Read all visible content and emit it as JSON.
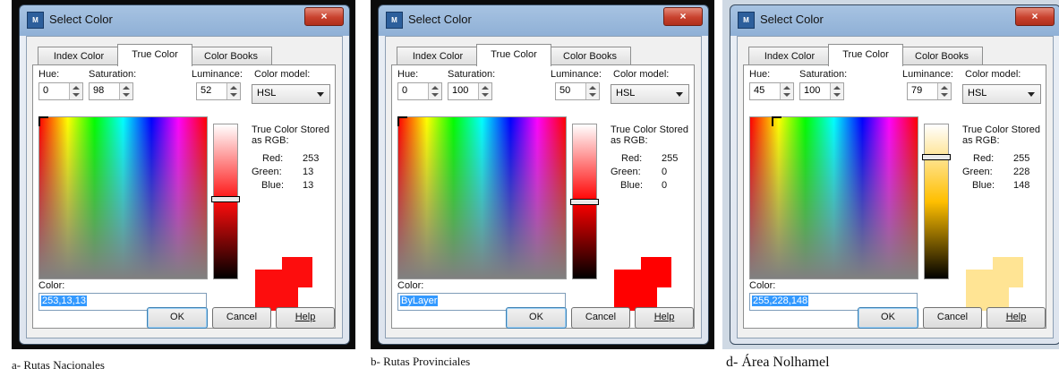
{
  "dialog_common": {
    "title": "Select Color",
    "close": "×",
    "app_icon": "M",
    "tabs": [
      "Index Color",
      "True Color",
      "Color Books"
    ],
    "labels": {
      "hue": "Hue:",
      "saturation": "Saturation:",
      "luminance": "Luminance:",
      "color_model": "Color model:",
      "stored": "True Color Stored as RGB:",
      "red": "Red:",
      "green": "Green:",
      "blue": "Blue:",
      "color": "Color:"
    },
    "buttons": {
      "ok": "OK",
      "cancel": "Cancel",
      "help": "Help"
    }
  },
  "panels": [
    {
      "hue": "0",
      "saturation": "98",
      "luminance": "52",
      "color_model": "HSL",
      "red": "253",
      "green": "13",
      "blue": "13",
      "color_value": "253,13,13",
      "luminance_level": 0.52,
      "swatch_color": "#fd0d0d",
      "bar_color": "#fd0d0d",
      "caption": "a- Rutas Nacionales"
    },
    {
      "hue": "0",
      "saturation": "100",
      "luminance": "50",
      "color_model": "HSL",
      "red": "255",
      "green": "0",
      "blue": "0",
      "color_value": "ByLayer",
      "luminance_level": 0.5,
      "swatch_color": "#ff0000",
      "bar_color": "#ff0000",
      "caption": "b- Rutas Provinciales"
    },
    {
      "hue": "45",
      "saturation": "100",
      "luminance": "79",
      "color_model": "HSL",
      "red": "255",
      "green": "228",
      "blue": "148",
      "color_value": "255,228,148",
      "luminance_level": 0.79,
      "swatch_color": "#ffe494",
      "bar_color": "#ffbf00",
      "caption": "d- Área Nolhamel"
    }
  ]
}
